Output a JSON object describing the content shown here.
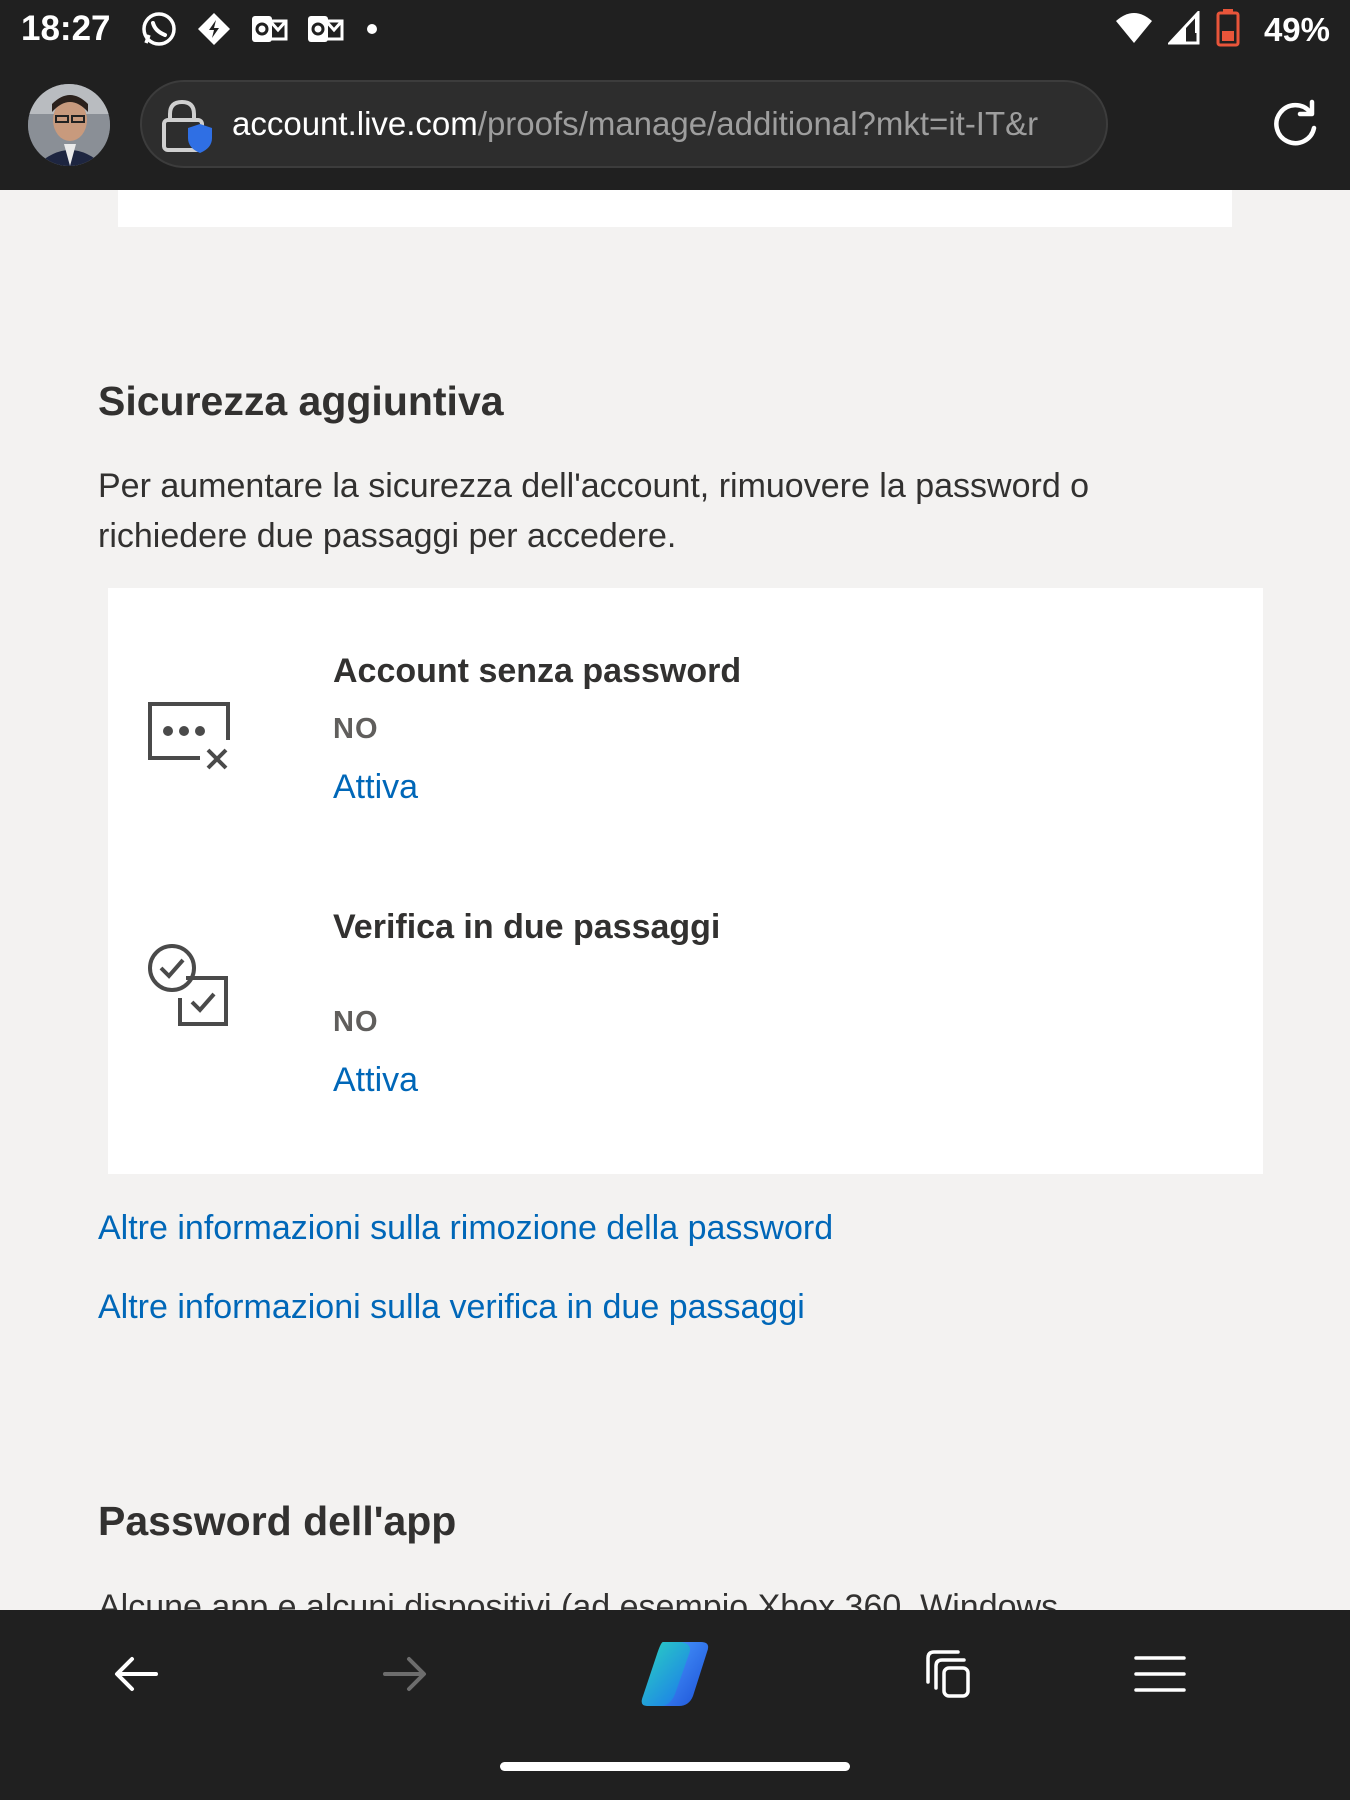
{
  "status_bar": {
    "time": "18:27",
    "battery_percent": "49%",
    "notification_icons": [
      "whatsapp-icon",
      "messenger-icon",
      "outlook-icon",
      "outlook-icon",
      "more-dot-icon"
    ],
    "system_icons": [
      "wifi-icon",
      "signal-icon",
      "battery-low-icon"
    ]
  },
  "browser": {
    "url_host": "account.live.com",
    "url_path": "/proofs/manage/additional?mkt=it-IT&r",
    "icons": [
      "profile-avatar",
      "site-lock-shield-icon",
      "reload-icon"
    ]
  },
  "page": {
    "security": {
      "title": "Sicurezza aggiuntiva",
      "description": "Per aumentare la sicurezza dell'account, rimuovere la password o richiedere due passaggi per accedere.",
      "options": [
        {
          "title": "Account senza password",
          "status": "NO",
          "action": "Attiva",
          "icon": "passwordless-icon"
        },
        {
          "title": "Verifica in due passaggi",
          "status": "NO",
          "action": "Attiva",
          "icon": "two-step-verification-icon"
        }
      ],
      "links": [
        "Altre informazioni sulla rimozione della password",
        "Altre informazioni sulla verifica in due passaggi"
      ]
    },
    "app_passwords": {
      "title": "Password dell'app",
      "description_partial": "Alcune app e alcuni dispositivi (ad esempio Xbox 360, Windows"
    }
  },
  "bottom_bar": {
    "buttons": [
      "back-icon",
      "forward-icon",
      "copilot-icon",
      "tabs-icon",
      "menu-icon"
    ]
  },
  "colors": {
    "link": "#0067b8",
    "page_background": "#f3f2f1",
    "card_background": "#ffffff",
    "chrome": "#202020"
  }
}
